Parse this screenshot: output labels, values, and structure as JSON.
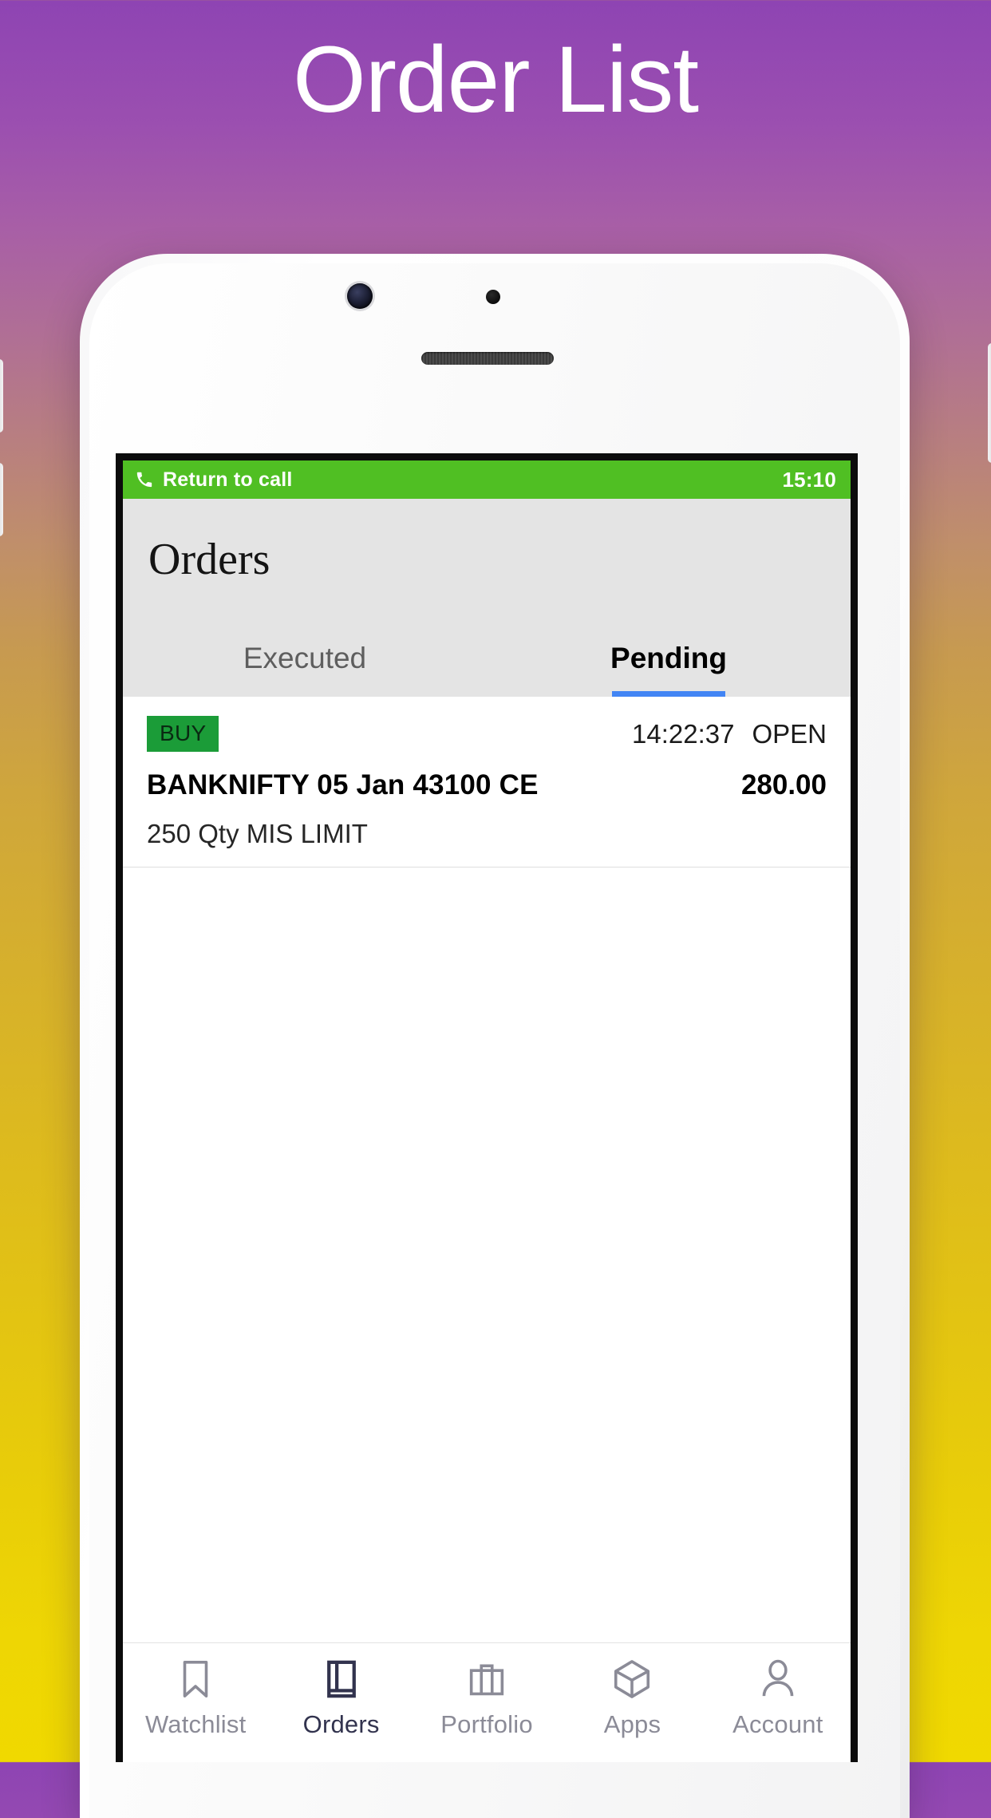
{
  "banner": {
    "title": "Order List"
  },
  "statusbar": {
    "call_label": "Return to call",
    "time": "15:10",
    "phone_icon": "phone-icon",
    "bg_color": "#50bf23"
  },
  "app": {
    "title": "Orders",
    "tabs": [
      {
        "label": "Executed",
        "active": false
      },
      {
        "label": "Pending",
        "active": true
      }
    ],
    "active_tab_underline_color": "#4285f4"
  },
  "orders": [
    {
      "side": "BUY",
      "side_color": "#1b9c38",
      "time": "14:22:37",
      "status": "OPEN",
      "instrument": "BANKNIFTY 05 Jan 43100  CE",
      "price": "280.00",
      "details": "250 Qty  MIS  LIMIT"
    }
  ],
  "bottom_nav": [
    {
      "label": "Watchlist",
      "icon": "bookmark-icon",
      "active": false
    },
    {
      "label": "Orders",
      "icon": "book-icon",
      "active": true
    },
    {
      "label": "Portfolio",
      "icon": "briefcase-icon",
      "active": false
    },
    {
      "label": "Apps",
      "icon": "cube-icon",
      "active": false
    },
    {
      "label": "Account",
      "icon": "person-icon",
      "active": false
    }
  ]
}
